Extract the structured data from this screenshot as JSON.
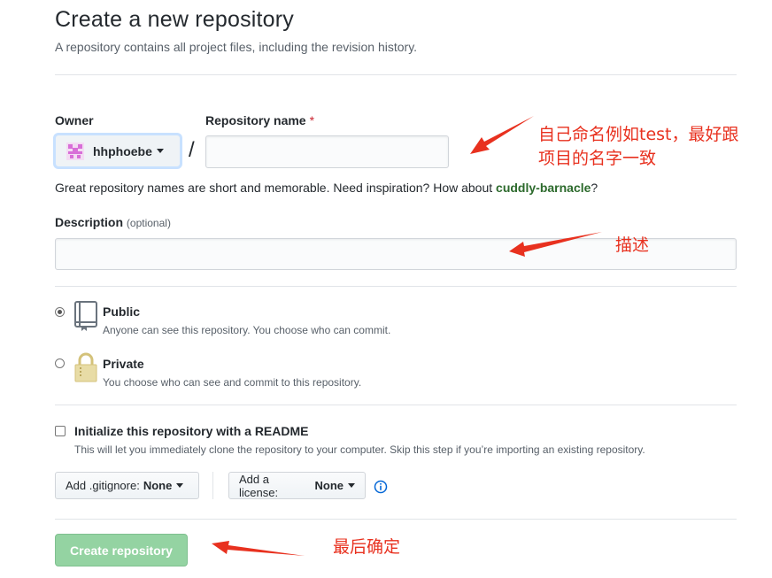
{
  "header": {
    "title": "Create a new repository",
    "subtitle": "A repository contains all project files, including the revision history."
  },
  "owner": {
    "label": "Owner",
    "value": "hhphoebe",
    "avatar_color": "#d86fd8"
  },
  "repo_name": {
    "label": "Repository name",
    "required_mark": "*",
    "value": "",
    "placeholder": ""
  },
  "separator": "/",
  "hint": {
    "text": "Great repository names are short and memorable. Need inspiration? How about ",
    "suggestion": "cuddly-barnacle",
    "end": "?"
  },
  "description": {
    "label": "Description",
    "optional": "(optional)",
    "value": ""
  },
  "visibility": {
    "selected": "public",
    "public": {
      "title": "Public",
      "note": "Anyone can see this repository. You choose who can commit."
    },
    "private": {
      "title": "Private",
      "note": "You choose who can see and commit to this repository."
    }
  },
  "readme": {
    "checked": false,
    "title": "Initialize this repository with a README",
    "note": "This will let you immediately clone the repository to your computer. Skip this step if you’re importing an existing repository."
  },
  "gitignore": {
    "prefix": "Add .gitignore:",
    "value": "None"
  },
  "license": {
    "prefix": "Add a license:",
    "value": "None"
  },
  "submit": {
    "label": "Create repository"
  },
  "annotations": {
    "name_line1": "自己命名例如test，最好跟",
    "name_line2": "项目的名字一致",
    "description": "描述",
    "submit": "最后确定",
    "color": "#e8311f"
  },
  "colors": {
    "accent_green": "#94d3a2",
    "link_blue": "#0366d6",
    "required_red": "#cb2431"
  }
}
